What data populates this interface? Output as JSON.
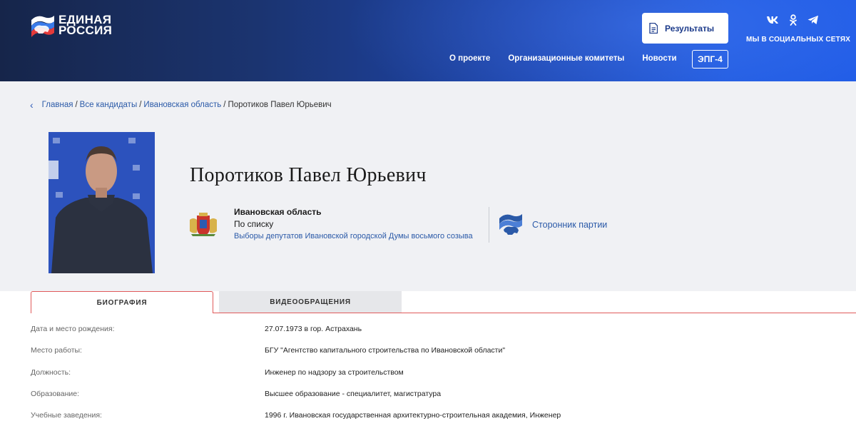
{
  "header": {
    "logo_line1": "ЕДИНАЯ",
    "logo_line2": "РОССИЯ",
    "results_label": "Результаты",
    "social_label": "МЫ В СОЦИАЛЬНЫХ СЕТЯХ",
    "social_icons": [
      "vk-icon",
      "odnoklassniki-icon",
      "telegram-icon"
    ],
    "nav": {
      "about": "О проекте",
      "committees": "Организационные комитеты",
      "news": "Новости",
      "epg": "ЭПГ-4"
    }
  },
  "breadcrumb": {
    "home": "Главная",
    "all_candidates": "Все кандидаты",
    "region": "Ивановская область",
    "current": "Поротиков Павел Юрьевич",
    "separator": "/"
  },
  "candidate": {
    "name": "Поротиков Павел Юрьевич",
    "region": "Ивановская область",
    "list_type": "По списку",
    "elections": "Выборы депутатов Ивановской городской Думы восьмого созыва",
    "status": "Сторонник партии"
  },
  "tabs": {
    "biography": "БИОГРАФИЯ",
    "video": "ВИДЕООБРАЩЕНИЯ"
  },
  "bio": [
    {
      "label": "Дата и место рождения:",
      "value": "27.07.1973 в гор. Астрахань"
    },
    {
      "label": "Место работы:",
      "value": "БГУ \"Агентство капитального строительства по Ивановской области\""
    },
    {
      "label": "Должность:",
      "value": "Инженер по надзору за строительством"
    },
    {
      "label": "Образование:",
      "value": "Высшее образование - специалитет, магистратура"
    },
    {
      "label": "Учебные заведения:",
      "value": "1996 г. Ивановская государственная архитектурно-строительная академия, Инженер"
    }
  ],
  "colors": {
    "header_dark": "#16254a",
    "header_bright": "#1f5be6",
    "link": "#2b5aa8",
    "tab_accent": "#e05a5a",
    "profile_bg": "#f0f1f4"
  }
}
